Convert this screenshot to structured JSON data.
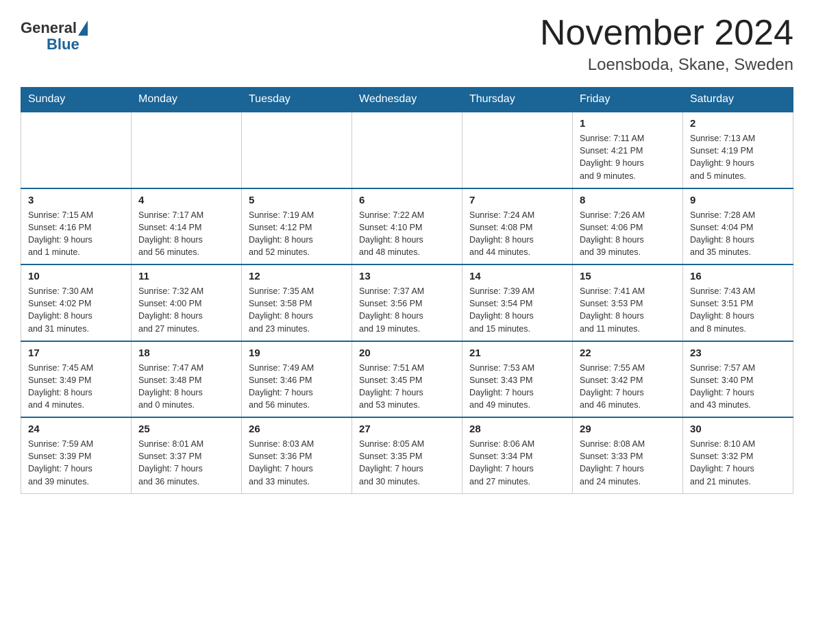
{
  "header": {
    "logo_general": "General",
    "logo_blue": "Blue",
    "month_title": "November 2024",
    "location": "Loensboda, Skane, Sweden"
  },
  "weekdays": [
    "Sunday",
    "Monday",
    "Tuesday",
    "Wednesday",
    "Thursday",
    "Friday",
    "Saturday"
  ],
  "weeks": [
    [
      {
        "day": "",
        "info": ""
      },
      {
        "day": "",
        "info": ""
      },
      {
        "day": "",
        "info": ""
      },
      {
        "day": "",
        "info": ""
      },
      {
        "day": "",
        "info": ""
      },
      {
        "day": "1",
        "info": "Sunrise: 7:11 AM\nSunset: 4:21 PM\nDaylight: 9 hours\nand 9 minutes."
      },
      {
        "day": "2",
        "info": "Sunrise: 7:13 AM\nSunset: 4:19 PM\nDaylight: 9 hours\nand 5 minutes."
      }
    ],
    [
      {
        "day": "3",
        "info": "Sunrise: 7:15 AM\nSunset: 4:16 PM\nDaylight: 9 hours\nand 1 minute."
      },
      {
        "day": "4",
        "info": "Sunrise: 7:17 AM\nSunset: 4:14 PM\nDaylight: 8 hours\nand 56 minutes."
      },
      {
        "day": "5",
        "info": "Sunrise: 7:19 AM\nSunset: 4:12 PM\nDaylight: 8 hours\nand 52 minutes."
      },
      {
        "day": "6",
        "info": "Sunrise: 7:22 AM\nSunset: 4:10 PM\nDaylight: 8 hours\nand 48 minutes."
      },
      {
        "day": "7",
        "info": "Sunrise: 7:24 AM\nSunset: 4:08 PM\nDaylight: 8 hours\nand 44 minutes."
      },
      {
        "day": "8",
        "info": "Sunrise: 7:26 AM\nSunset: 4:06 PM\nDaylight: 8 hours\nand 39 minutes."
      },
      {
        "day": "9",
        "info": "Sunrise: 7:28 AM\nSunset: 4:04 PM\nDaylight: 8 hours\nand 35 minutes."
      }
    ],
    [
      {
        "day": "10",
        "info": "Sunrise: 7:30 AM\nSunset: 4:02 PM\nDaylight: 8 hours\nand 31 minutes."
      },
      {
        "day": "11",
        "info": "Sunrise: 7:32 AM\nSunset: 4:00 PM\nDaylight: 8 hours\nand 27 minutes."
      },
      {
        "day": "12",
        "info": "Sunrise: 7:35 AM\nSunset: 3:58 PM\nDaylight: 8 hours\nand 23 minutes."
      },
      {
        "day": "13",
        "info": "Sunrise: 7:37 AM\nSunset: 3:56 PM\nDaylight: 8 hours\nand 19 minutes."
      },
      {
        "day": "14",
        "info": "Sunrise: 7:39 AM\nSunset: 3:54 PM\nDaylight: 8 hours\nand 15 minutes."
      },
      {
        "day": "15",
        "info": "Sunrise: 7:41 AM\nSunset: 3:53 PM\nDaylight: 8 hours\nand 11 minutes."
      },
      {
        "day": "16",
        "info": "Sunrise: 7:43 AM\nSunset: 3:51 PM\nDaylight: 8 hours\nand 8 minutes."
      }
    ],
    [
      {
        "day": "17",
        "info": "Sunrise: 7:45 AM\nSunset: 3:49 PM\nDaylight: 8 hours\nand 4 minutes."
      },
      {
        "day": "18",
        "info": "Sunrise: 7:47 AM\nSunset: 3:48 PM\nDaylight: 8 hours\nand 0 minutes."
      },
      {
        "day": "19",
        "info": "Sunrise: 7:49 AM\nSunset: 3:46 PM\nDaylight: 7 hours\nand 56 minutes."
      },
      {
        "day": "20",
        "info": "Sunrise: 7:51 AM\nSunset: 3:45 PM\nDaylight: 7 hours\nand 53 minutes."
      },
      {
        "day": "21",
        "info": "Sunrise: 7:53 AM\nSunset: 3:43 PM\nDaylight: 7 hours\nand 49 minutes."
      },
      {
        "day": "22",
        "info": "Sunrise: 7:55 AM\nSunset: 3:42 PM\nDaylight: 7 hours\nand 46 minutes."
      },
      {
        "day": "23",
        "info": "Sunrise: 7:57 AM\nSunset: 3:40 PM\nDaylight: 7 hours\nand 43 minutes."
      }
    ],
    [
      {
        "day": "24",
        "info": "Sunrise: 7:59 AM\nSunset: 3:39 PM\nDaylight: 7 hours\nand 39 minutes."
      },
      {
        "day": "25",
        "info": "Sunrise: 8:01 AM\nSunset: 3:37 PM\nDaylight: 7 hours\nand 36 minutes."
      },
      {
        "day": "26",
        "info": "Sunrise: 8:03 AM\nSunset: 3:36 PM\nDaylight: 7 hours\nand 33 minutes."
      },
      {
        "day": "27",
        "info": "Sunrise: 8:05 AM\nSunset: 3:35 PM\nDaylight: 7 hours\nand 30 minutes."
      },
      {
        "day": "28",
        "info": "Sunrise: 8:06 AM\nSunset: 3:34 PM\nDaylight: 7 hours\nand 27 minutes."
      },
      {
        "day": "29",
        "info": "Sunrise: 8:08 AM\nSunset: 3:33 PM\nDaylight: 7 hours\nand 24 minutes."
      },
      {
        "day": "30",
        "info": "Sunrise: 8:10 AM\nSunset: 3:32 PM\nDaylight: 7 hours\nand 21 minutes."
      }
    ]
  ]
}
